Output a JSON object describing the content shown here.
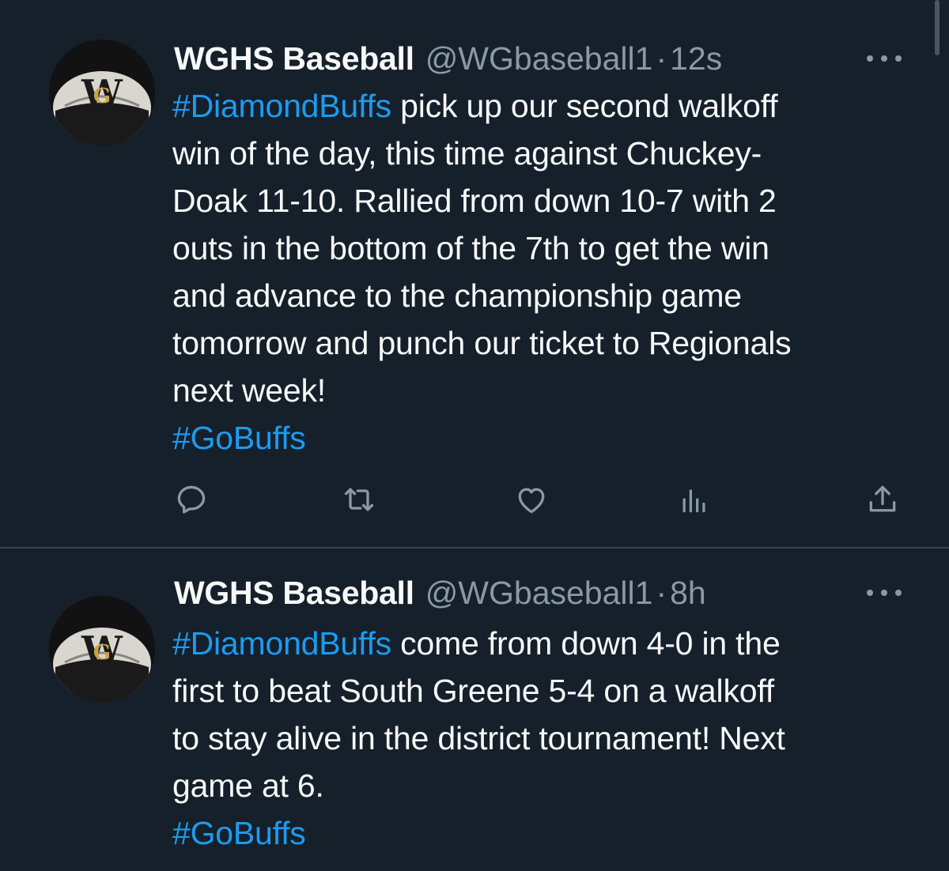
{
  "tweets": [
    {
      "name": "WGHS Baseball",
      "handle": "@WGbaseball1",
      "separator": "·",
      "time": "12s",
      "text_lines": [
        [
          {
            "text": "#DiamondBuffs",
            "tag": true
          },
          {
            "text": " pick up our second walkoff",
            "tag": false
          }
        ],
        [
          {
            "text": "win of the day, this time against Chuckey-",
            "tag": false
          }
        ],
        [
          {
            "text": "Doak 11-10. Rallied from down 10-7 with 2",
            "tag": false
          }
        ],
        [
          {
            "text": "outs in the bottom of the 7th to get the win",
            "tag": false
          }
        ],
        [
          {
            "text": "and advance to the championship game",
            "tag": false
          }
        ],
        [
          {
            "text": "tomorrow and punch our ticket to Regionals",
            "tag": false
          }
        ],
        [
          {
            "text": "next week!",
            "tag": false
          }
        ],
        [
          {
            "text": "#GoBuffs",
            "tag": true
          }
        ]
      ],
      "actions": [
        {
          "icon": "reply-icon"
        },
        {
          "icon": "retweet-icon"
        },
        {
          "icon": "like-icon"
        },
        {
          "icon": "views-icon"
        },
        {
          "icon": "share-icon"
        }
      ]
    },
    {
      "name": "WGHS Baseball",
      "handle": "@WGbaseball1",
      "separator": "·",
      "time": "8h",
      "text_lines": [
        [
          {
            "text": "#DiamondBuffs",
            "tag": true
          },
          {
            "text": " come from down 4-0 in the",
            "tag": false
          }
        ],
        [
          {
            "text": "first to beat South Greene 5-4 on a walkoff",
            "tag": false
          }
        ],
        [
          {
            "text": "to stay alive in the district tournament! Next",
            "tag": false
          }
        ],
        [
          {
            "text": "game at 6.",
            "tag": false
          }
        ],
        [
          {
            "text": "#GoBuffs",
            "tag": true
          }
        ]
      ]
    }
  ],
  "colors": {
    "background": "#15202b",
    "text": "#f7f9f9",
    "muted": "#8b98a5",
    "hashtag": "#1d9bf0",
    "divider": "#38444d"
  },
  "avatar": {
    "monogram_top": "W",
    "monogram_inner": "G"
  }
}
